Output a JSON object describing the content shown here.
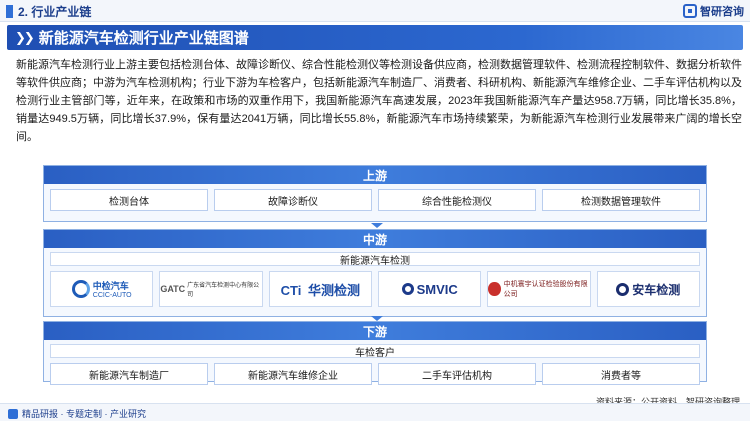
{
  "header": {
    "section_title": "2. 行业产业链",
    "brand_name": "智研咨询"
  },
  "title_bar": {
    "title": "新能源汽车检测行业产业链图谱"
  },
  "intro_paragraph": "新能源汽车检测行业上游主要包括检测台体、故障诊断仪、综合性能检测仪等检测设备供应商，检测数据管理软件、检测流程控制软件、数据分析软件等软件供应商；中游为汽车检测机构；行业下游为车检客户，包括新能源汽车制造厂、消费者、科研机构、新能源汽车维修企业、二手车评估机构以及检测行业主管部门等，近年来，在政策和市场的双重作用下，我国新能源汽车高速发展，2023年我国新能源汽车产量达958.7万辆，同比增长35.8%，销量达949.5万辆，同比增长37.9%，保有量达2041万辆，同比增长55.8%，新能源汽车市场持续繁荣，为新能源汽车检测行业发展带来广阔的增长空间。",
  "upstream": {
    "label": "上游",
    "items": [
      "检测台体",
      "故障诊断仪",
      "综合性能检测仪",
      "检测数据管理软件"
    ]
  },
  "midstream": {
    "label": "中游",
    "sub_label": "新能源汽车检测",
    "logos": [
      {
        "icon": "ccic-auto-logo",
        "text": "中检汽车",
        "sub": "CCIC-AUTO"
      },
      {
        "icon": "gatc-logo",
        "text": "GATC",
        "sub": "广东省汽车检测中心有限公司"
      },
      {
        "icon": "cti-logo",
        "text": "CTi",
        "sub": "华测检测"
      },
      {
        "icon": "smvic-logo",
        "text": "SMVIC",
        "sub": ""
      },
      {
        "icon": "cnas-seal-logo",
        "text": "中机寰宇认证检验股份有限公司",
        "sub": ""
      },
      {
        "icon": "anche-logo",
        "text": "安车检测",
        "sub": ""
      }
    ]
  },
  "downstream": {
    "label": "下游",
    "sub_label": "车检客户",
    "items": [
      "新能源汽车制造厂",
      "新能源汽车维修企业",
      "二手车评估机构",
      "消费者等"
    ]
  },
  "source": "资料来源：公开资料、智研咨询整理",
  "footer": {
    "tagline": "精品研报 · 专题定制 · 产业研究"
  },
  "colors": {
    "primary": "#2a5fc3",
    "title_dark": "#1c3e8c",
    "panel_bg": "#f4f8fe"
  }
}
